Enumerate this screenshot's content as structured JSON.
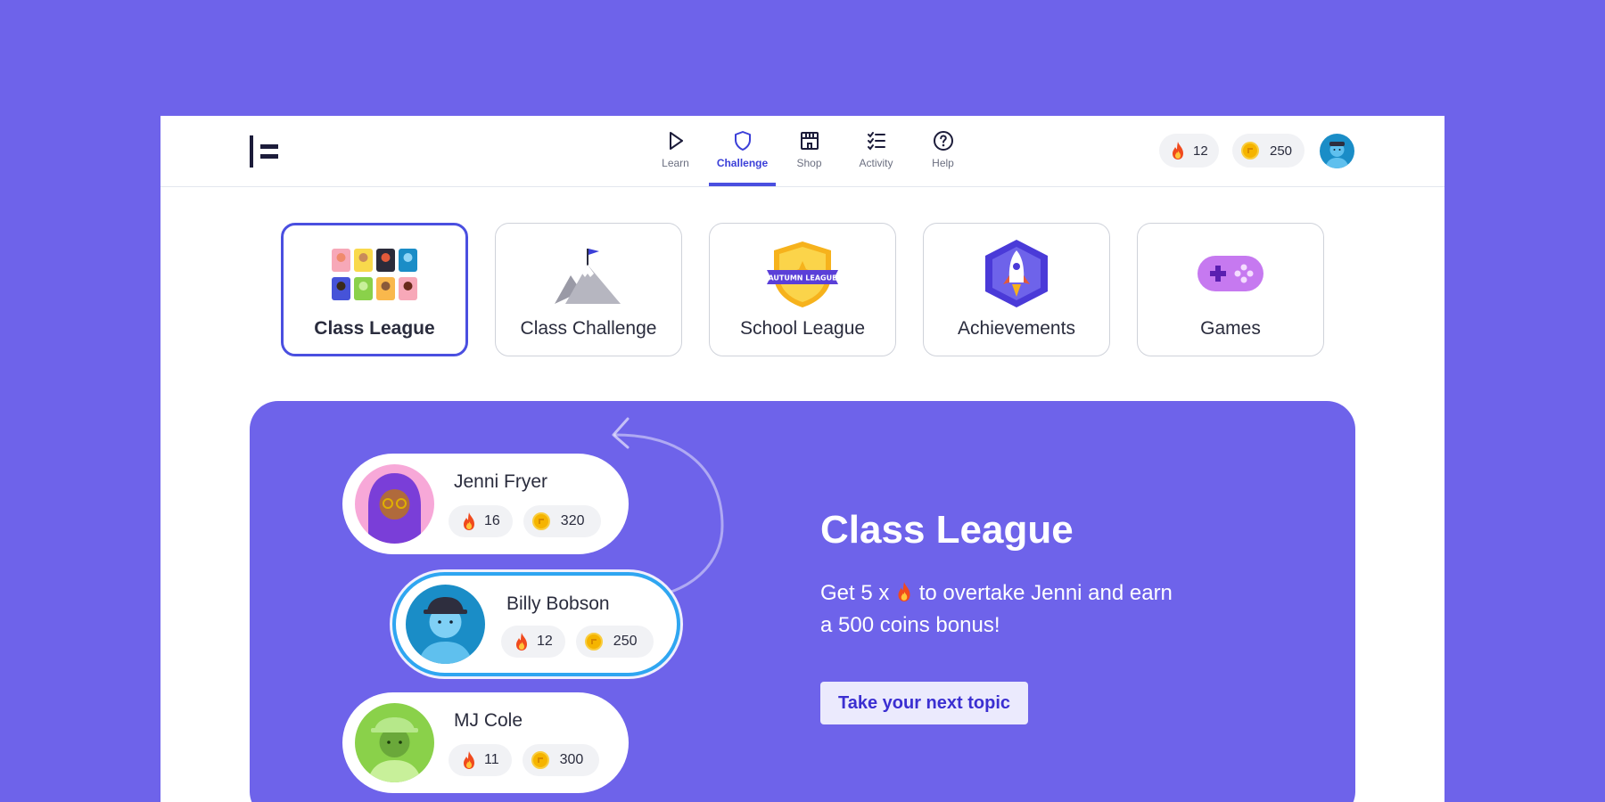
{
  "nav": {
    "items": [
      {
        "label": "Learn",
        "icon": "play-icon"
      },
      {
        "label": "Challenge",
        "icon": "shield-icon",
        "active": true
      },
      {
        "label": "Shop",
        "icon": "shop-icon"
      },
      {
        "label": "Activity",
        "icon": "checklist-icon"
      },
      {
        "label": "Help",
        "icon": "help-icon"
      }
    ]
  },
  "header": {
    "streak": "12",
    "coins": "250"
  },
  "cards": [
    {
      "label": "Class League",
      "selected": true
    },
    {
      "label": "Class Challenge"
    },
    {
      "label": "School League",
      "badge_text": "AUTUMN LEAGUE"
    },
    {
      "label": "Achievements"
    },
    {
      "label": "Games"
    }
  ],
  "players": [
    {
      "name": "Jenni Fryer",
      "streak": "16",
      "coins": "320"
    },
    {
      "name": "Billy Bobson",
      "streak": "12",
      "coins": "250",
      "is_me": true
    },
    {
      "name": "MJ Cole",
      "streak": "11",
      "coins": "300"
    }
  ],
  "panel": {
    "title": "Class League",
    "text_before": "Get 5 x ",
    "text_after": " to overtake Jenni and earn a 500 coins bonus!",
    "cta": "Take your next topic"
  },
  "colors": {
    "background": "#6e63ea",
    "accent": "#4a4fe0",
    "my_player_border": "#2fa6f1",
    "coin": "#f5b400"
  }
}
